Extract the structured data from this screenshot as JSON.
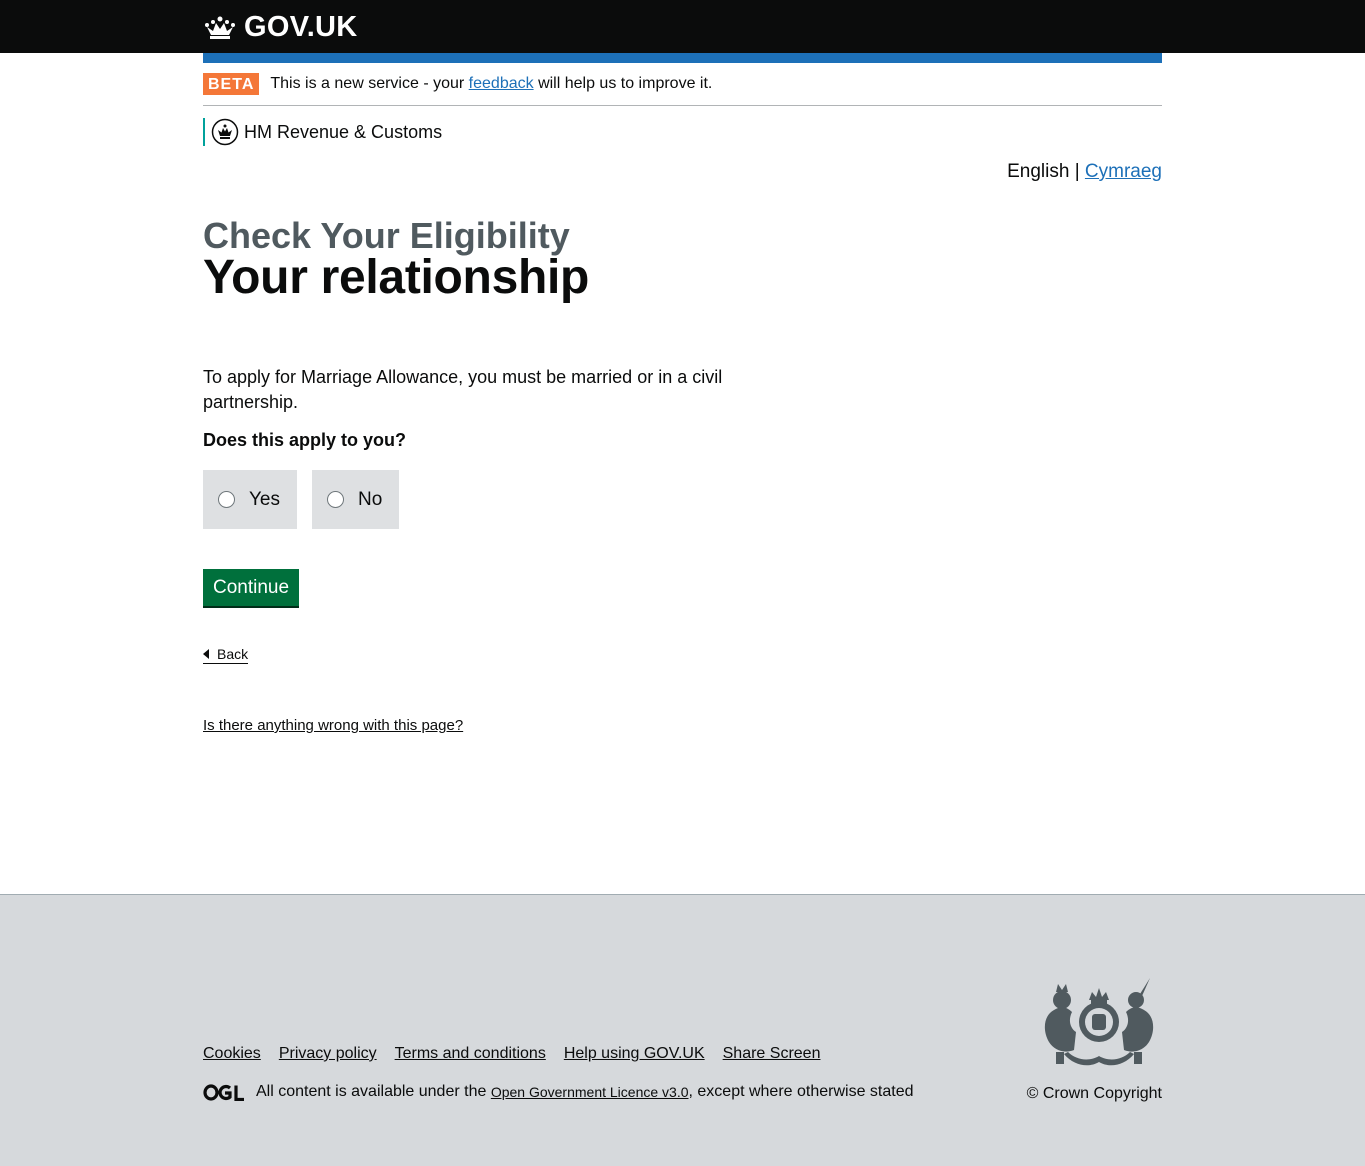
{
  "header": {
    "logo_text": "GOV.UK"
  },
  "phase_banner": {
    "tag": "BETA",
    "text_before": "This is a new service - your",
    "link": "feedback",
    "text_after": "will help us to improve it."
  },
  "organisation": {
    "name": "HM Revenue & Customs"
  },
  "language": {
    "current": "English",
    "separator": "|",
    "other": "Cymraeg"
  },
  "main": {
    "caption": "Check Your Eligibility",
    "heading": "Your relationship",
    "intro": "To apply for Marriage Allowance, you must be married or in a civil partnership.",
    "question": "Does this apply to you?",
    "options": [
      {
        "label": "Yes"
      },
      {
        "label": "No"
      }
    ],
    "continue_label": "Continue",
    "back_label": "Back",
    "report_link": "Is there anything wrong with this page?"
  },
  "footer": {
    "links": [
      {
        "label": "Cookies"
      },
      {
        "label": "Privacy policy"
      },
      {
        "label": "Terms and conditions"
      },
      {
        "label": "Help using GOV.UK"
      },
      {
        "label": "Share Screen"
      }
    ],
    "licence_before": "All content is available under the",
    "licence_link": "Open Government Licence v3.0",
    "licence_after": ", except where otherwise stated",
    "copyright": "© Crown Copyright"
  },
  "colors": {
    "header_bg": "#0b0c0c",
    "blue_bar": "#1d70b8",
    "beta_tag": "#f47738",
    "link": "#1d70b8",
    "button": "#00703c",
    "footer_bg": "#d6d9dc"
  }
}
